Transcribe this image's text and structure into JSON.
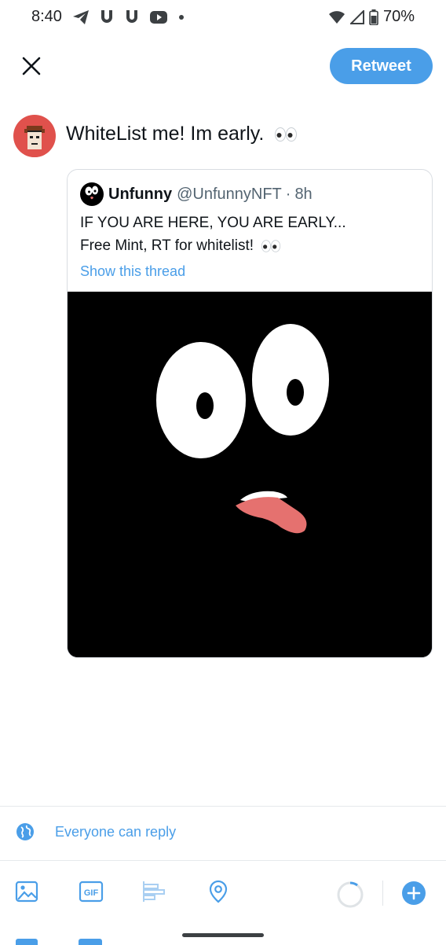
{
  "status_bar": {
    "time": "8:40",
    "battery": "70%",
    "left_icons": [
      "telegram-icon",
      "magnet-icon",
      "magnet-icon",
      "youtube-icon",
      "dot-icon"
    ],
    "right_icons": [
      "wifi-icon",
      "signal-icon",
      "battery-icon"
    ]
  },
  "header": {
    "retweet_label": "Retweet"
  },
  "compose": {
    "text": "WhiteList me! Im early."
  },
  "quoted_tweet": {
    "name": "Unfunny",
    "handle": "@UnfunnyNFT",
    "separator": "·",
    "time": "8h",
    "line1": "IF YOU ARE HERE, YOU ARE EARLY...",
    "line2": "Free Mint, RT for whitelist!",
    "show_thread": "Show this thread"
  },
  "reply_setting": {
    "label": "Everyone can reply"
  },
  "toolbar": {
    "items": [
      "image-icon",
      "gif-icon",
      "poll-icon",
      "location-icon",
      "character-count-ring-icon",
      "add-tweet-icon"
    ],
    "gif_label": "GIF"
  },
  "colors": {
    "accent": "#4a9ee8",
    "text_primary": "#0f1419",
    "text_secondary": "#536471",
    "tongue": "#e5716f"
  }
}
